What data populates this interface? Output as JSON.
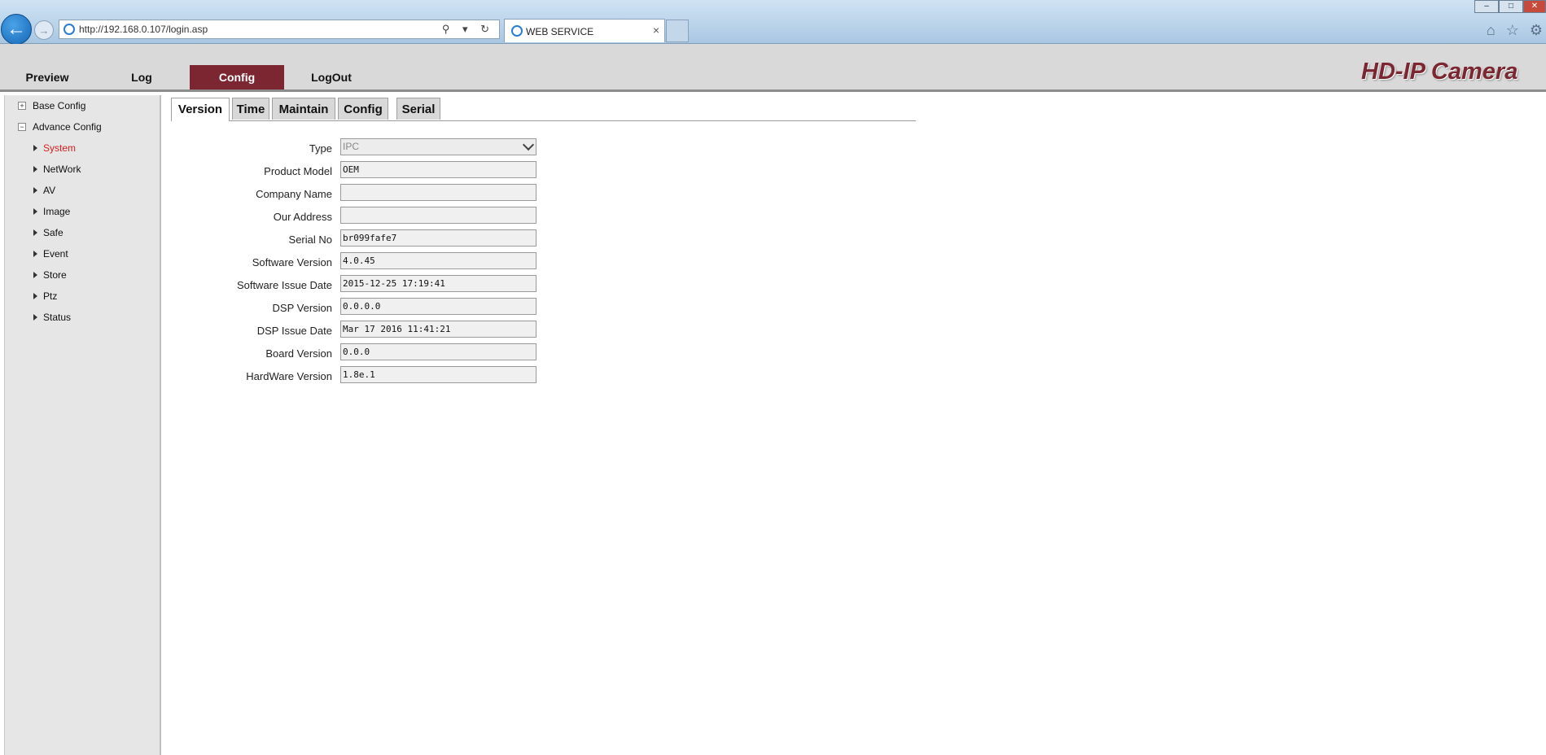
{
  "browser": {
    "url": "http://192.168.0.107/login.asp",
    "tab_title": "WEB SERVICE",
    "tab_close": "×",
    "search_tools": "⚲ ▾ ↻",
    "right_icons": "⌂ ☆ ⚙",
    "back_glyph": "←",
    "forward_glyph": "→",
    "window_controls": {
      "minimize": "–",
      "maximize": "□",
      "close": "✕"
    }
  },
  "menu": {
    "items": [
      {
        "label": "Preview",
        "active": false
      },
      {
        "label": "Log",
        "active": false
      },
      {
        "label": "Config",
        "active": true
      },
      {
        "label": "LogOut",
        "active": false
      }
    ],
    "brand": "HD-IP Camera"
  },
  "sidebar": {
    "roots": [
      {
        "label": "Base Config",
        "expanded": false,
        "glyph": "+"
      },
      {
        "label": "Advance Config",
        "expanded": true,
        "glyph": "−"
      }
    ],
    "items": [
      {
        "label": "System",
        "selected": true
      },
      {
        "label": "NetWork",
        "selected": false
      },
      {
        "label": "AV",
        "selected": false
      },
      {
        "label": "Image",
        "selected": false
      },
      {
        "label": "Safe",
        "selected": false
      },
      {
        "label": "Event",
        "selected": false
      },
      {
        "label": "Store",
        "selected": false
      },
      {
        "label": "Ptz",
        "selected": false
      },
      {
        "label": "Status",
        "selected": false
      }
    ]
  },
  "tabs": [
    {
      "label": "Version",
      "active": true
    },
    {
      "label": "Time",
      "active": false
    },
    {
      "label": "Maintain",
      "active": false
    },
    {
      "label": "Config",
      "active": false
    },
    {
      "label": "Serial",
      "active": false
    }
  ],
  "form": {
    "type": {
      "label": "Type",
      "value": "IPC"
    },
    "fields": [
      {
        "label": "Product Model",
        "value": "OEM"
      },
      {
        "label": "Company Name",
        "value": ""
      },
      {
        "label": "Our Address",
        "value": ""
      },
      {
        "label": "Serial No",
        "value": "br099fafe7"
      },
      {
        "label": "Software Version",
        "value": "4.0.45"
      },
      {
        "label": "Software Issue Date",
        "value": "2015-12-25 17:19:41"
      },
      {
        "label": "DSP Version",
        "value": "0.0.0.0"
      },
      {
        "label": "DSP Issue Date",
        "value": "Mar 17 2016 11:41:21"
      },
      {
        "label": "Board Version",
        "value": "0.0.0"
      },
      {
        "label": "HardWare Version",
        "value": "1.8e.1"
      }
    ]
  },
  "colors": {
    "accent": "#7b2630",
    "selected_item": "#d81e1e",
    "menubar_bg": "#d9d9d9",
    "sidebar_bg": "#e6e6e6"
  }
}
